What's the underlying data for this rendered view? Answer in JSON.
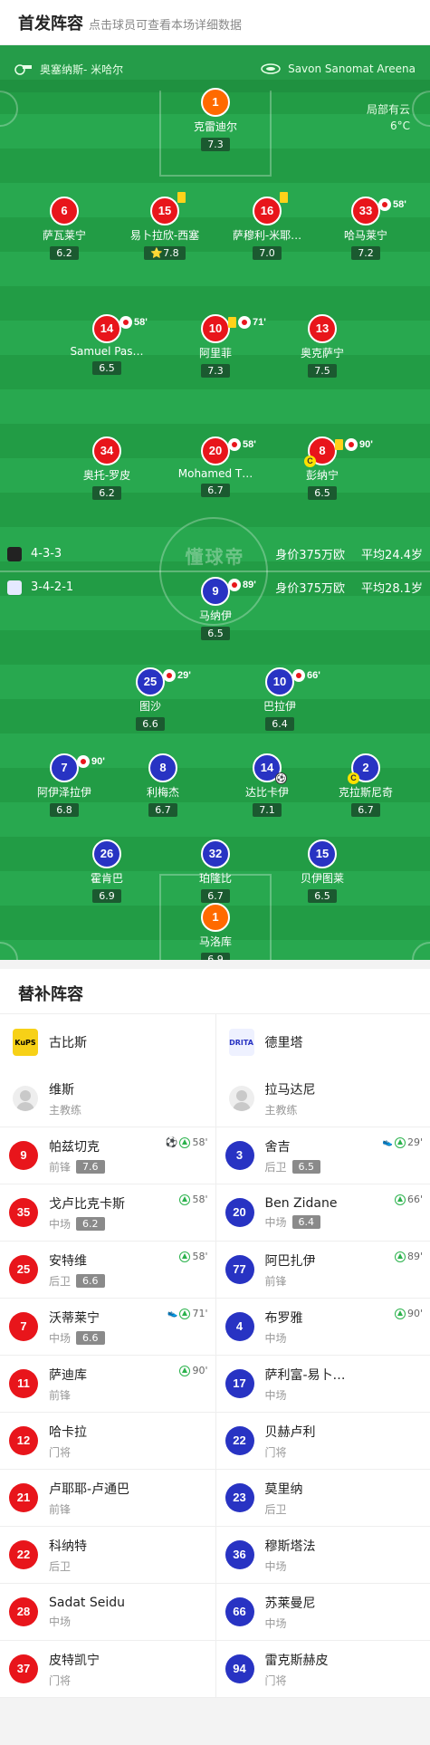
{
  "header": {
    "title": "首发阵容",
    "subtitle": "点击球员可查看本场详细数据"
  },
  "venue": {
    "coach_left": "奥塞纳斯- 米哈尔",
    "stadium": "Savon Sanomat Areena"
  },
  "weather": {
    "condition": "局部有云",
    "temp": "6°C"
  },
  "watermark": "懂球帝",
  "home_form": {
    "formation": "4-3-3",
    "value": "身价375万欧",
    "age": "平均24.4岁"
  },
  "away_form": {
    "formation": "3-4-2-1",
    "value": "身价375万欧",
    "age": "平均28.1岁"
  },
  "home_players": [
    {
      "num": "1",
      "name": "克雷迪尔",
      "rating": "7.3",
      "color": "org"
    },
    {
      "num": "6",
      "name": "萨瓦莱宁",
      "rating": "6.2",
      "color": "red"
    },
    {
      "num": "15",
      "name": "易卜拉欣-西塞",
      "rating": "7.8",
      "color": "red",
      "star": "⭐",
      "yc": true
    },
    {
      "num": "16",
      "name": "萨穆利-米耶…",
      "rating": "7.0",
      "color": "red",
      "yc": true
    },
    {
      "num": "33",
      "name": "哈马莱宁",
      "rating": "7.2",
      "color": "red",
      "subtime": "58'"
    },
    {
      "num": "14",
      "name": "Samuel Pas…",
      "rating": "6.5",
      "color": "red",
      "subtime": "58'"
    },
    {
      "num": "10",
      "name": "阿里菲",
      "rating": "7.3",
      "color": "red",
      "yc": true,
      "subtime": "71'"
    },
    {
      "num": "13",
      "name": "奥克萨宁",
      "rating": "7.5",
      "color": "red"
    },
    {
      "num": "34",
      "name": "奥托-罗皮",
      "rating": "6.2",
      "color": "red"
    },
    {
      "num": "20",
      "name": "Mohamed T…",
      "rating": "6.7",
      "color": "red",
      "subtime": "58'"
    },
    {
      "num": "8",
      "name": "彭纳宁",
      "rating": "6.5",
      "color": "red",
      "yc": true,
      "subtime": "90'",
      "cap": "C"
    }
  ],
  "away_players": [
    {
      "num": "9",
      "name": "马纳伊",
      "rating": "6.5",
      "color": "blue",
      "subtime": "89'"
    },
    {
      "num": "25",
      "name": "图沙",
      "rating": "6.6",
      "color": "blue",
      "subtime": "29'"
    },
    {
      "num": "10",
      "name": "巴拉伊",
      "rating": "6.4",
      "color": "blue",
      "subtime": "66'"
    },
    {
      "num": "7",
      "name": "阿伊泽拉伊",
      "rating": "6.8",
      "color": "blue",
      "subtime": "90'"
    },
    {
      "num": "8",
      "name": "利梅杰",
      "rating": "6.7",
      "color": "blue"
    },
    {
      "num": "14",
      "name": "达比卡伊",
      "rating": "7.1",
      "color": "blue",
      "ball": "⚽"
    },
    {
      "num": "2",
      "name": "克拉斯尼奇",
      "rating": "6.7",
      "color": "blue",
      "cap": "C"
    },
    {
      "num": "26",
      "name": "霍肯巴",
      "rating": "6.9",
      "color": "blue"
    },
    {
      "num": "32",
      "name": "珀隆比",
      "rating": "6.7",
      "color": "blue"
    },
    {
      "num": "15",
      "name": "贝伊图莱",
      "rating": "6.5",
      "color": "blue"
    },
    {
      "num": "1",
      "name": "马洛库",
      "rating": "6.9",
      "color": "org"
    }
  ],
  "subs": {
    "title": "替补阵容",
    "left": {
      "team": "古比斯",
      "team_logo": "KuPS",
      "coach": "维斯",
      "coach_role": "主教练",
      "players": [
        {
          "num": "9",
          "name": "帕兹切克",
          "pos": "前锋",
          "rating": "7.6",
          "ev": "58'",
          "goal": "⚽"
        },
        {
          "num": "35",
          "name": "戈卢比克卡斯",
          "pos": "中场",
          "rating": "6.2",
          "ev": "58'"
        },
        {
          "num": "25",
          "name": "安特维",
          "pos": "后卫",
          "rating": "6.6",
          "ev": "58'"
        },
        {
          "num": "7",
          "name": "沃蒂莱宁",
          "pos": "中场",
          "rating": "6.6",
          "ev": "71'",
          "assist": "👟"
        },
        {
          "num": "11",
          "name": "萨迪库",
          "pos": "前锋",
          "ev": "90'"
        },
        {
          "num": "12",
          "name": "哈卡拉",
          "pos": "门将"
        },
        {
          "num": "21",
          "name": "卢耶耶-卢通巴",
          "pos": "前锋"
        },
        {
          "num": "22",
          "name": "科纳特",
          "pos": "后卫"
        },
        {
          "num": "28",
          "name": "Sadat Seidu",
          "pos": "中场"
        },
        {
          "num": "37",
          "name": "皮特凯宁",
          "pos": "门将"
        }
      ]
    },
    "right": {
      "team": "德里塔",
      "team_logo": "DRITA",
      "coach": "拉马达尼",
      "coach_role": "主教练",
      "players": [
        {
          "num": "3",
          "name": "舍吉",
          "pos": "后卫",
          "rating": "6.5",
          "ev": "29'",
          "assist": "👟"
        },
        {
          "num": "20",
          "name": "Ben Zidane",
          "pos": "中场",
          "rating": "6.4",
          "ev": "66'"
        },
        {
          "num": "77",
          "name": "阿巴扎伊",
          "pos": "前锋",
          "ev": "89'"
        },
        {
          "num": "4",
          "name": "布罗雅",
          "pos": "中场",
          "ev": "90'"
        },
        {
          "num": "17",
          "name": "萨利富-易卜…",
          "pos": "中场"
        },
        {
          "num": "22",
          "name": "贝赫卢利",
          "pos": "门将"
        },
        {
          "num": "23",
          "name": "莫里纳",
          "pos": "后卫"
        },
        {
          "num": "36",
          "name": "穆斯塔法",
          "pos": "中场"
        },
        {
          "num": "66",
          "name": "苏莱曼尼",
          "pos": "中场"
        },
        {
          "num": "94",
          "name": "雷克斯赫皮",
          "pos": "门将"
        }
      ]
    }
  },
  "colors": {
    "home": "#e8151b",
    "away": "#2833c3",
    "keeper": "#ff6a00",
    "pitch": "#23a34a"
  }
}
